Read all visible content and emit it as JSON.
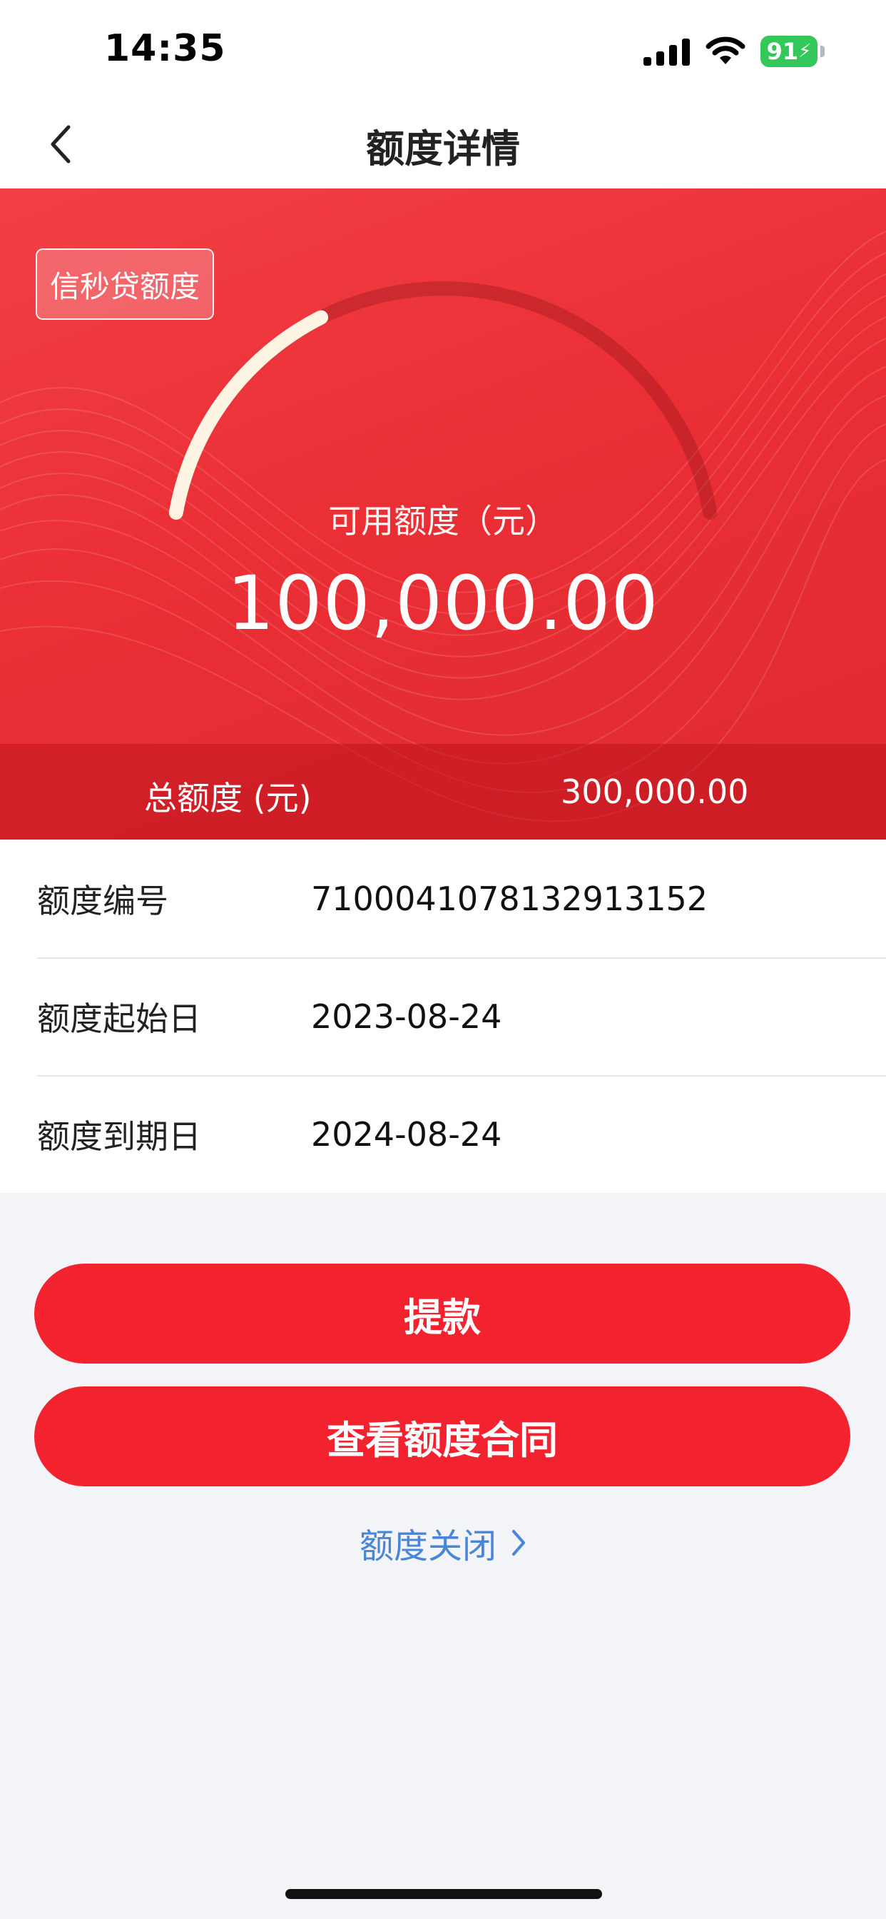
{
  "status_bar": {
    "time": "14:35",
    "battery": "91"
  },
  "nav": {
    "title": "额度详情",
    "back_icon": "chevron-left-icon"
  },
  "hero": {
    "tag": "信秒贷额度",
    "available_label": "可用额度（元）",
    "available_amount": "100,000.00",
    "available_fraction": 0.333,
    "total_label": "总额度 (元)",
    "total_value": "300,000.00"
  },
  "info": [
    {
      "label": "额度编号",
      "value": "7100041078132913152"
    },
    {
      "label": "额度起始日",
      "value": "2023-08-24"
    },
    {
      "label": "额度到期日",
      "value": "2024-08-24"
    }
  ],
  "actions": {
    "withdraw": "提款",
    "view_contract": "查看额度合同",
    "close_quota": "额度关闭"
  },
  "colors": {
    "brand_red": "#f2222f",
    "link_blue": "#4a86d6",
    "gauge_fill": "#fdf4e3"
  }
}
